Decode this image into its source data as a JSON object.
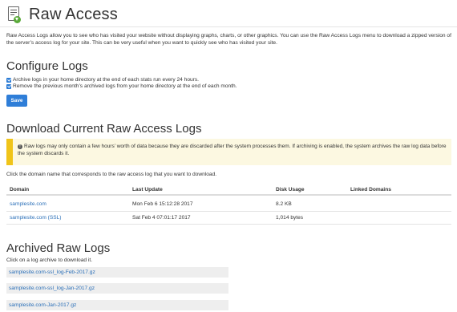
{
  "header": {
    "title": "Raw Access",
    "icon": "raw-access-icon"
  },
  "intro": "Raw Access Logs allow you to see who has visited your website without displaying graphs, charts, or other graphics. You can use the Raw Access Logs menu to download a zipped version of the server’s access log for your site. This can be very useful when you want to quickly see who has visited your site.",
  "configure": {
    "heading": "Configure Logs",
    "options": [
      {
        "label": "Archive logs in your home directory at the end of each stats run every 24 hours.",
        "checked": true
      },
      {
        "label": "Remove the previous month’s archived logs from your home directory at the end of each month.",
        "checked": true
      }
    ],
    "save_label": "Save"
  },
  "download": {
    "heading": "Download Current Raw Access Logs",
    "warning": "Raw logs may only contain a few hours’ worth of data because they are discarded after the system processes them. If archiving is enabled, the system archives the raw log data before the system discards it.",
    "instruction": "Click the domain name that corresponds to the raw access log that you want to download.",
    "columns": [
      "Domain",
      "Last Update",
      "Disk Usage",
      "Linked Domains"
    ],
    "rows": [
      {
        "domain": "samplesite.com",
        "last_update": "Mon Feb 6 15:12:28 2017",
        "disk_usage": "8.2 KB",
        "linked": ""
      },
      {
        "domain": "samplesite.com (SSL)",
        "last_update": "Sat Feb 4 07:01:17 2017",
        "disk_usage": "1,014 bytes",
        "linked": ""
      }
    ]
  },
  "archived": {
    "heading": "Archived Raw Logs",
    "instruction": "Click on a log archive to download it.",
    "files": [
      "samplesite.com-ssl_log-Feb-2017.gz",
      "samplesite.com-ssl_log-Jan-2017.gz",
      "samplesite.com-Jan-2017.gz"
    ]
  },
  "colors": {
    "accent": "#2f7ed8",
    "link": "#2a6fb8",
    "warning_bar": "#f0c419",
    "warning_bg": "#fcf8e1"
  }
}
